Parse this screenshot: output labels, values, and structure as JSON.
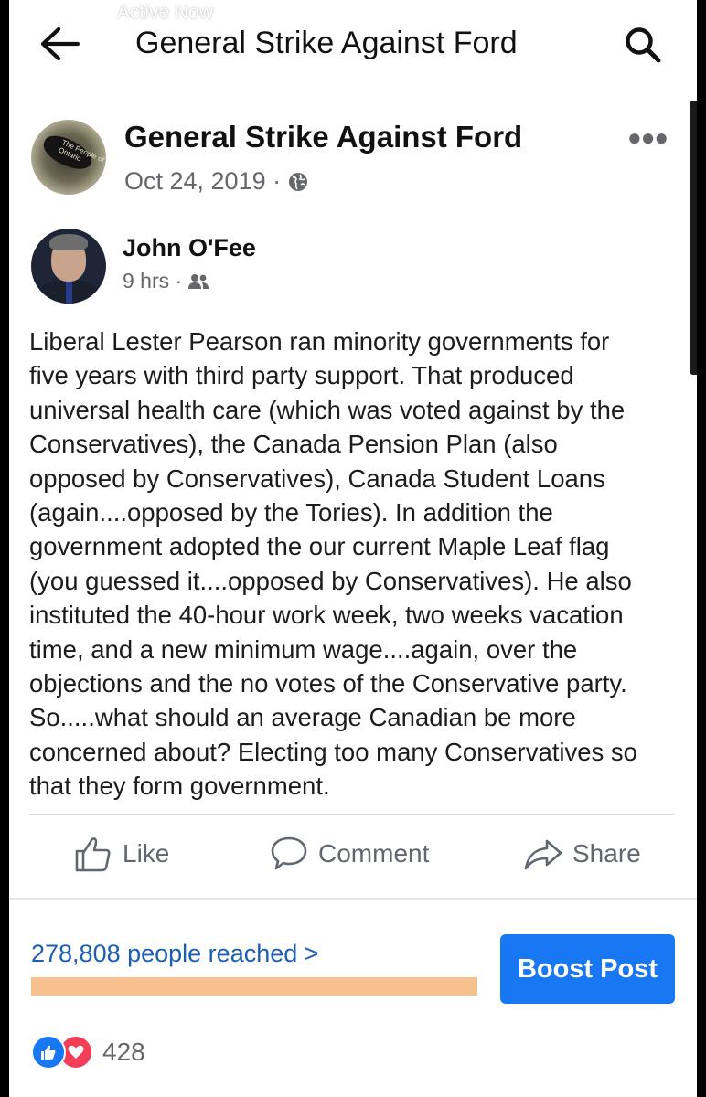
{
  "status_bar": {
    "ghost_text": "Active Now"
  },
  "appbar": {
    "title": "General Strike Against Ford"
  },
  "page": {
    "name": "General Strike Against Ford",
    "date": "Oct 24, 2019 ·",
    "avatar_text": "The People of Ontario"
  },
  "post": {
    "author": "John O'Fee",
    "time": "9 hrs ·",
    "body_lines": [
      "Liberal Lester Pearson ran minority governments for",
      "five years with third party support. That produced",
      "universal health care (which was voted against by the",
      "Conservatives), the Canada Pension Plan (also",
      "opposed by Conservatives), Canada Student Loans",
      "(again....opposed by the Tories). In addition the",
      "government adopted the our current Maple Leaf flag",
      "(you guessed it....opposed by Conservatives). He also",
      "instituted the 40-hour work week, two weeks vacation",
      "time, and a new minimum wage....again, over the",
      "objections and the no votes of the Conservative party.",
      "So.....what should an average Canadian be more",
      "concerned about? Electing too many Conservatives so",
      "that they form government."
    ]
  },
  "actions": {
    "like": "Like",
    "comment": "Comment",
    "share": "Share"
  },
  "insights": {
    "reached": "278,808 people reached >",
    "reach_progress": 1.0,
    "boost_label": "Boost Post"
  },
  "reactions": {
    "count": "428"
  },
  "colors": {
    "accent": "#1877f2",
    "reach_bar": "#f6c18e",
    "reach_text": "#1b5fb3"
  }
}
